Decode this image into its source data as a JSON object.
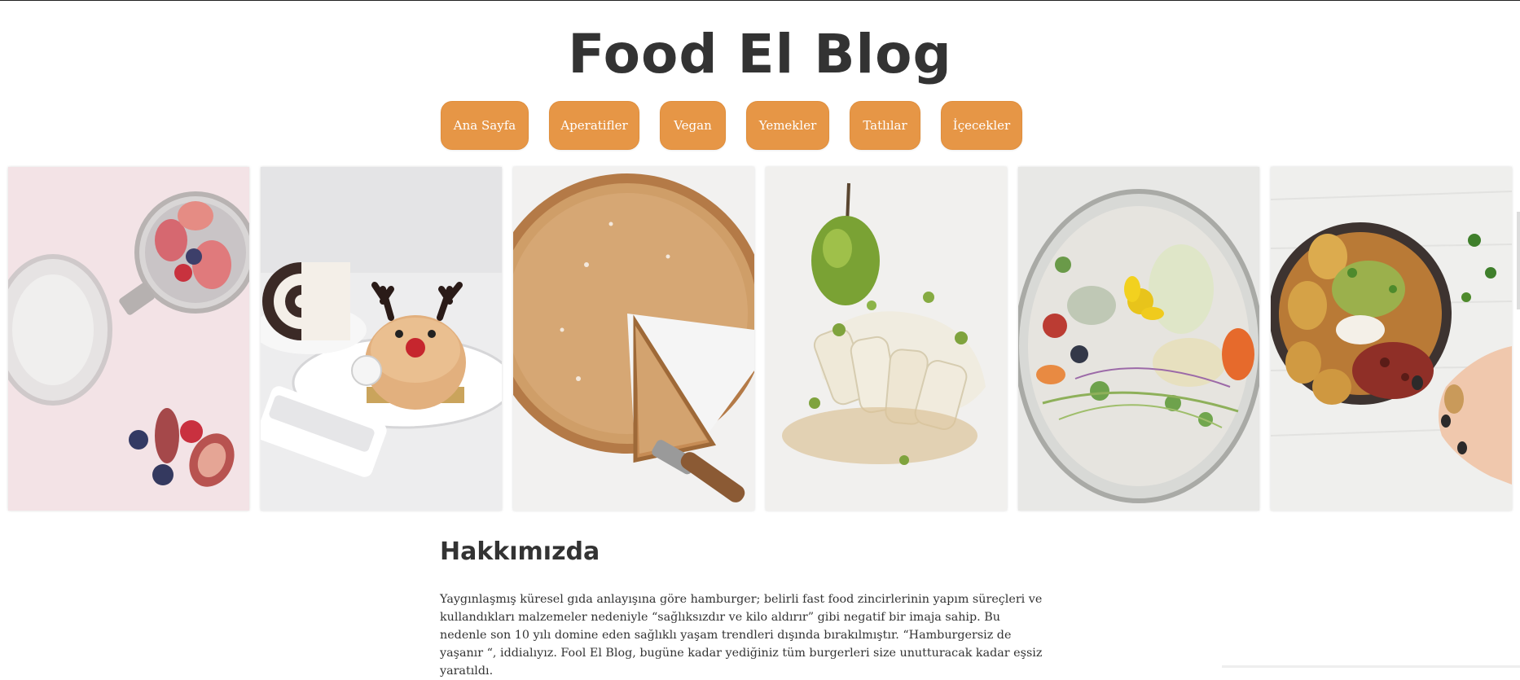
{
  "site": {
    "title": "Food El Blog"
  },
  "nav": {
    "items": [
      {
        "label": "Ana Sayfa"
      },
      {
        "label": "Aperatifler"
      },
      {
        "label": "Vegan"
      },
      {
        "label": "Yemekler"
      },
      {
        "label": "Tatlılar"
      },
      {
        "label": "İçecekler"
      }
    ]
  },
  "gallery": {
    "images": [
      {
        "name": "chia-pudding-figs"
      },
      {
        "name": "reindeer-cake-dessert"
      },
      {
        "name": "sliced-pie"
      },
      {
        "name": "pear-vegetable-plate"
      },
      {
        "name": "salad-in-glass"
      },
      {
        "name": "potato-guacamole-bowl"
      }
    ]
  },
  "about": {
    "heading": "Hakkımızda",
    "text": "Yaygınlaşmış küresel gıda anlayışına göre hamburger; belirli fast food zincirlerinin yapım süreçleri ve kullandıkları malzemeler nedeniyle “sağlıksızdır ve kilo aldırır” gibi negatif bir imaja sahip. Bu nedenle son 10 yılı domine eden sağlıklı yaşam trendleri dışında bırakılmıştır. “Hamburgersiz de yaşanır “, iddialıyız. Fool El Blog, bugüne kadar yediğiniz tüm burgerleri size unutturacak kadar eşsiz yaratıldı."
  },
  "colors": {
    "accent": "#e69646",
    "text": "#333333"
  }
}
